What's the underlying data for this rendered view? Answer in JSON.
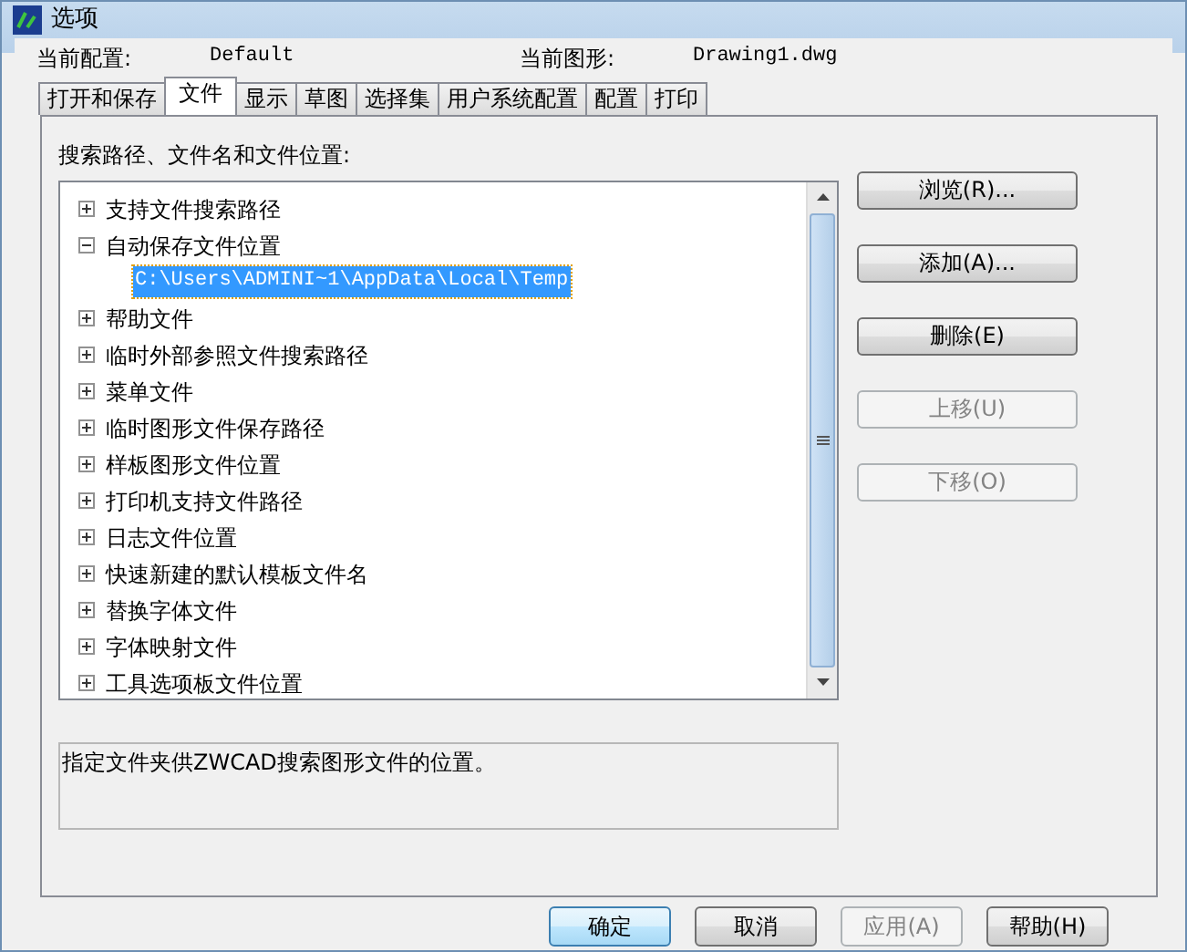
{
  "window": {
    "title": "选项"
  },
  "info": [
    {
      "label": "当前配置:",
      "value": "Default"
    },
    {
      "label": "当前图形:",
      "value": "Drawing1.dwg"
    }
  ],
  "tabs": [
    {
      "label": "打开和保存",
      "selected": false
    },
    {
      "label": "文件",
      "selected": true
    },
    {
      "label": "显示",
      "selected": false
    },
    {
      "label": "草图",
      "selected": false
    },
    {
      "label": "选择集",
      "selected": false
    },
    {
      "label": "用户系统配置",
      "selected": false
    },
    {
      "label": "配置",
      "selected": false
    },
    {
      "label": "打印",
      "selected": false
    }
  ],
  "tree_label": "搜索路径、文件名和文件位置:",
  "tree": [
    {
      "label": "支持文件搜索路径",
      "expanded": false,
      "selected": false
    },
    {
      "label": "自动保存文件位置",
      "expanded": true,
      "selected": false,
      "children": [
        {
          "label": "C:\\Users\\ADMINI~1\\AppData\\Local\\Temp",
          "selected": true
        }
      ]
    },
    {
      "label": "帮助文件",
      "expanded": false,
      "selected": false
    },
    {
      "label": "临时外部参照文件搜索路径",
      "expanded": false,
      "selected": false
    },
    {
      "label": "菜单文件",
      "expanded": false,
      "selected": false
    },
    {
      "label": "临时图形文件保存路径",
      "expanded": false,
      "selected": false
    },
    {
      "label": "样板图形文件位置",
      "expanded": false,
      "selected": false
    },
    {
      "label": "打印机支持文件路径",
      "expanded": false,
      "selected": false
    },
    {
      "label": "日志文件位置",
      "expanded": false,
      "selected": false
    },
    {
      "label": "快速新建的默认模板文件名",
      "expanded": false,
      "selected": false
    },
    {
      "label": "替换字体文件",
      "expanded": false,
      "selected": false
    },
    {
      "label": "字体映射文件",
      "expanded": false,
      "selected": false
    },
    {
      "label": "工具选项板文件位置",
      "expanded": false,
      "selected": false
    }
  ],
  "side_buttons": [
    {
      "label": "浏览(R)...",
      "disabled": false
    },
    {
      "label": "添加(A)...",
      "disabled": false
    },
    {
      "label": "删除(E)",
      "disabled": false
    },
    {
      "label": "上移(U)",
      "disabled": true
    },
    {
      "label": "下移(O)",
      "disabled": true
    }
  ],
  "description": "指定文件夹供ZWCAD搜索图形文件的位置。",
  "footer_buttons": [
    {
      "label": "确定",
      "disabled": false,
      "default": true
    },
    {
      "label": "取消",
      "disabled": false,
      "default": false
    },
    {
      "label": "应用(A)",
      "disabled": true,
      "default": false
    },
    {
      "label": "帮助(H)",
      "disabled": false,
      "default": false
    }
  ]
}
